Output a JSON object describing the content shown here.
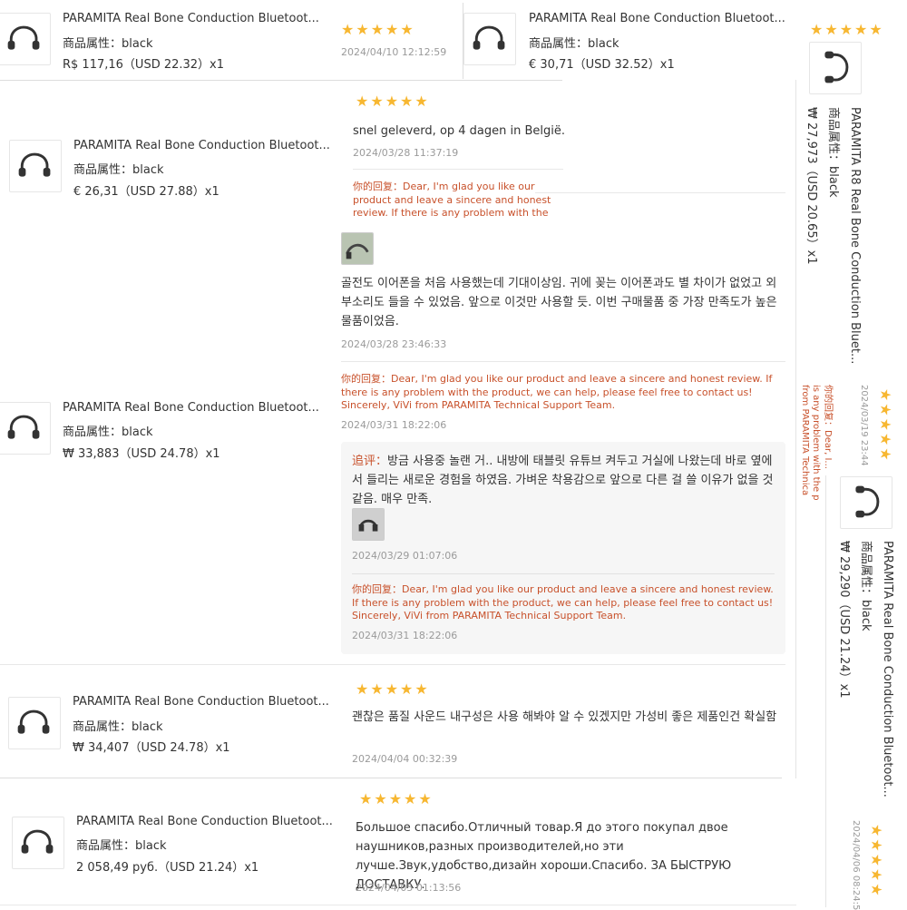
{
  "strip_top": {
    "product_title": "PARAMITA Real Bone Conduction Bluetoot...",
    "attr": "商品属性：black",
    "price": "R$ 117,16（USD  22.32）x1",
    "stars": "★★★★★",
    "date": "2024/04/10 12:12:59"
  },
  "strip_top_right": {
    "product_title": "PARAMITA Real Bone Conduction Bluetoot...",
    "attr": "商品属性：black",
    "price": "€ 30,71（USD  32.52）x1",
    "stars": "★★★★★"
  },
  "review1": {
    "product_title": "PARAMITA Real Bone Conduction Bluetoot...",
    "attr": "商品属性：black",
    "price": "€ 26,31（USD  27.88）x1",
    "stars": "★★★★★",
    "text": "snel geleverd, op 4 dagen in België.",
    "date": "2024/03/28 11:37:19",
    "reply_label": "你的回复：",
    "reply": "Dear, I'm glad you like our product and leave a sincere and honest review. If there is any problem with the product, we can help, please feel free to contact us! Sincerely, ViVi from PARAMITA Technical Support Team."
  },
  "review2": {
    "text": "골전도 이어폰을 처음 사용했는데 기대이상임. 귀에 꽂는 이어폰과도 별 차이가 없었고 외부소리도 들을 수 있었음. 앞으로 이것만 사용할 듯. 이번 구매물품 중 가장 만족도가 높은 물품이었음.",
    "date": "2024/03/28 23:46:33",
    "reply_label": "你的回复：",
    "reply": "Dear, I'm glad you like our product and leave a sincere and honest review. If there is any problem with the product, we can help, please feel free to contact us! Sincerely, ViVi from PARAMITA Technical Support Team.",
    "reply_date": "2024/03/31 18:22:06",
    "product_title": "PARAMITA Real Bone Conduction Bluetoot...",
    "attr": "商品属性：black",
    "price": "₩ 33,883（USD  24.78）x1",
    "followup_label": "追评：",
    "followup_text": "방금 사용중 놀랜 거.. 내방에 태블릿 유튜브 켜두고 거실에 나왔는데 바로 옆에서 들리는 새로운 경험을 하였음. 가벼운 착용감으로 앞으로 다른 걸 쓸 이유가 없을 것 같음. 매우 만족.",
    "followup_date": "2024/03/29 01:07:06",
    "followup_reply_label": "你的回复：",
    "followup_reply": "Dear, I'm glad you like our product and leave a sincere and honest review. If there is any problem with the product, we can help, please feel free to contact us! Sincerely, ViVi from PARAMITA Technical Support Team.",
    "followup_reply_date": "2024/03/31 18:22:06"
  },
  "review3": {
    "product_title": "PARAMITA Real Bone Conduction Bluetoot...",
    "attr": "商品属性：black",
    "price": "₩ 34,407（USD  24.78）x1",
    "stars": "★★★★★",
    "text": "괜찮은 품질 사운드 내구성은 사용 해봐야 알 수 있겠지만 가성비 좋은 제품인건 확실함",
    "date": "2024/04/04 00:32:39"
  },
  "review4": {
    "product_title": "PARAMITA Real Bone Conduction Bluetoot...",
    "attr": "商品属性：black",
    "price": "2 058,49 руб.（USD  21.24）x1",
    "stars": "★★★★★",
    "text": "Большое спасибо.Отличный товар.Я до этого покупал двое наушников,разных производителей,но эти лучше.Звук,удобство,дизайн хороши.Спасибо. ЗА БЫСТРУЮ ДОСТАВКУ.",
    "date": "2024/04/05 01:13:56"
  },
  "rot_right1": {
    "stars": "★★★★★",
    "product_title": "PARAMITA R8 Real Bone Conduction Bluet...",
    "attr": "商品属性：black",
    "price": "₩ 27,973（USD  20.65）x1",
    "date": "2024/03/19 23:44",
    "reply_label": "你的回复：",
    "reply_l1": "Dear, I...",
    "reply_l2": "is any problem with the p",
    "reply_l3": "from PARAMITA Technica"
  },
  "rot_right2": {
    "product_title": "PARAMITA Real Bone Conduction Bluetoot...",
    "attr": "商品属性：black",
    "price": "₩ 29,290（USD  21.24）x1",
    "date": "2024/04/06 08:24:5",
    "stars": "★★★★★"
  },
  "icons": {
    "product": "headphones-icon",
    "star": "star-icon"
  },
  "colors": {
    "star": "#f7b731",
    "reply": "#c8512b",
    "date": "#9a9a9a"
  }
}
